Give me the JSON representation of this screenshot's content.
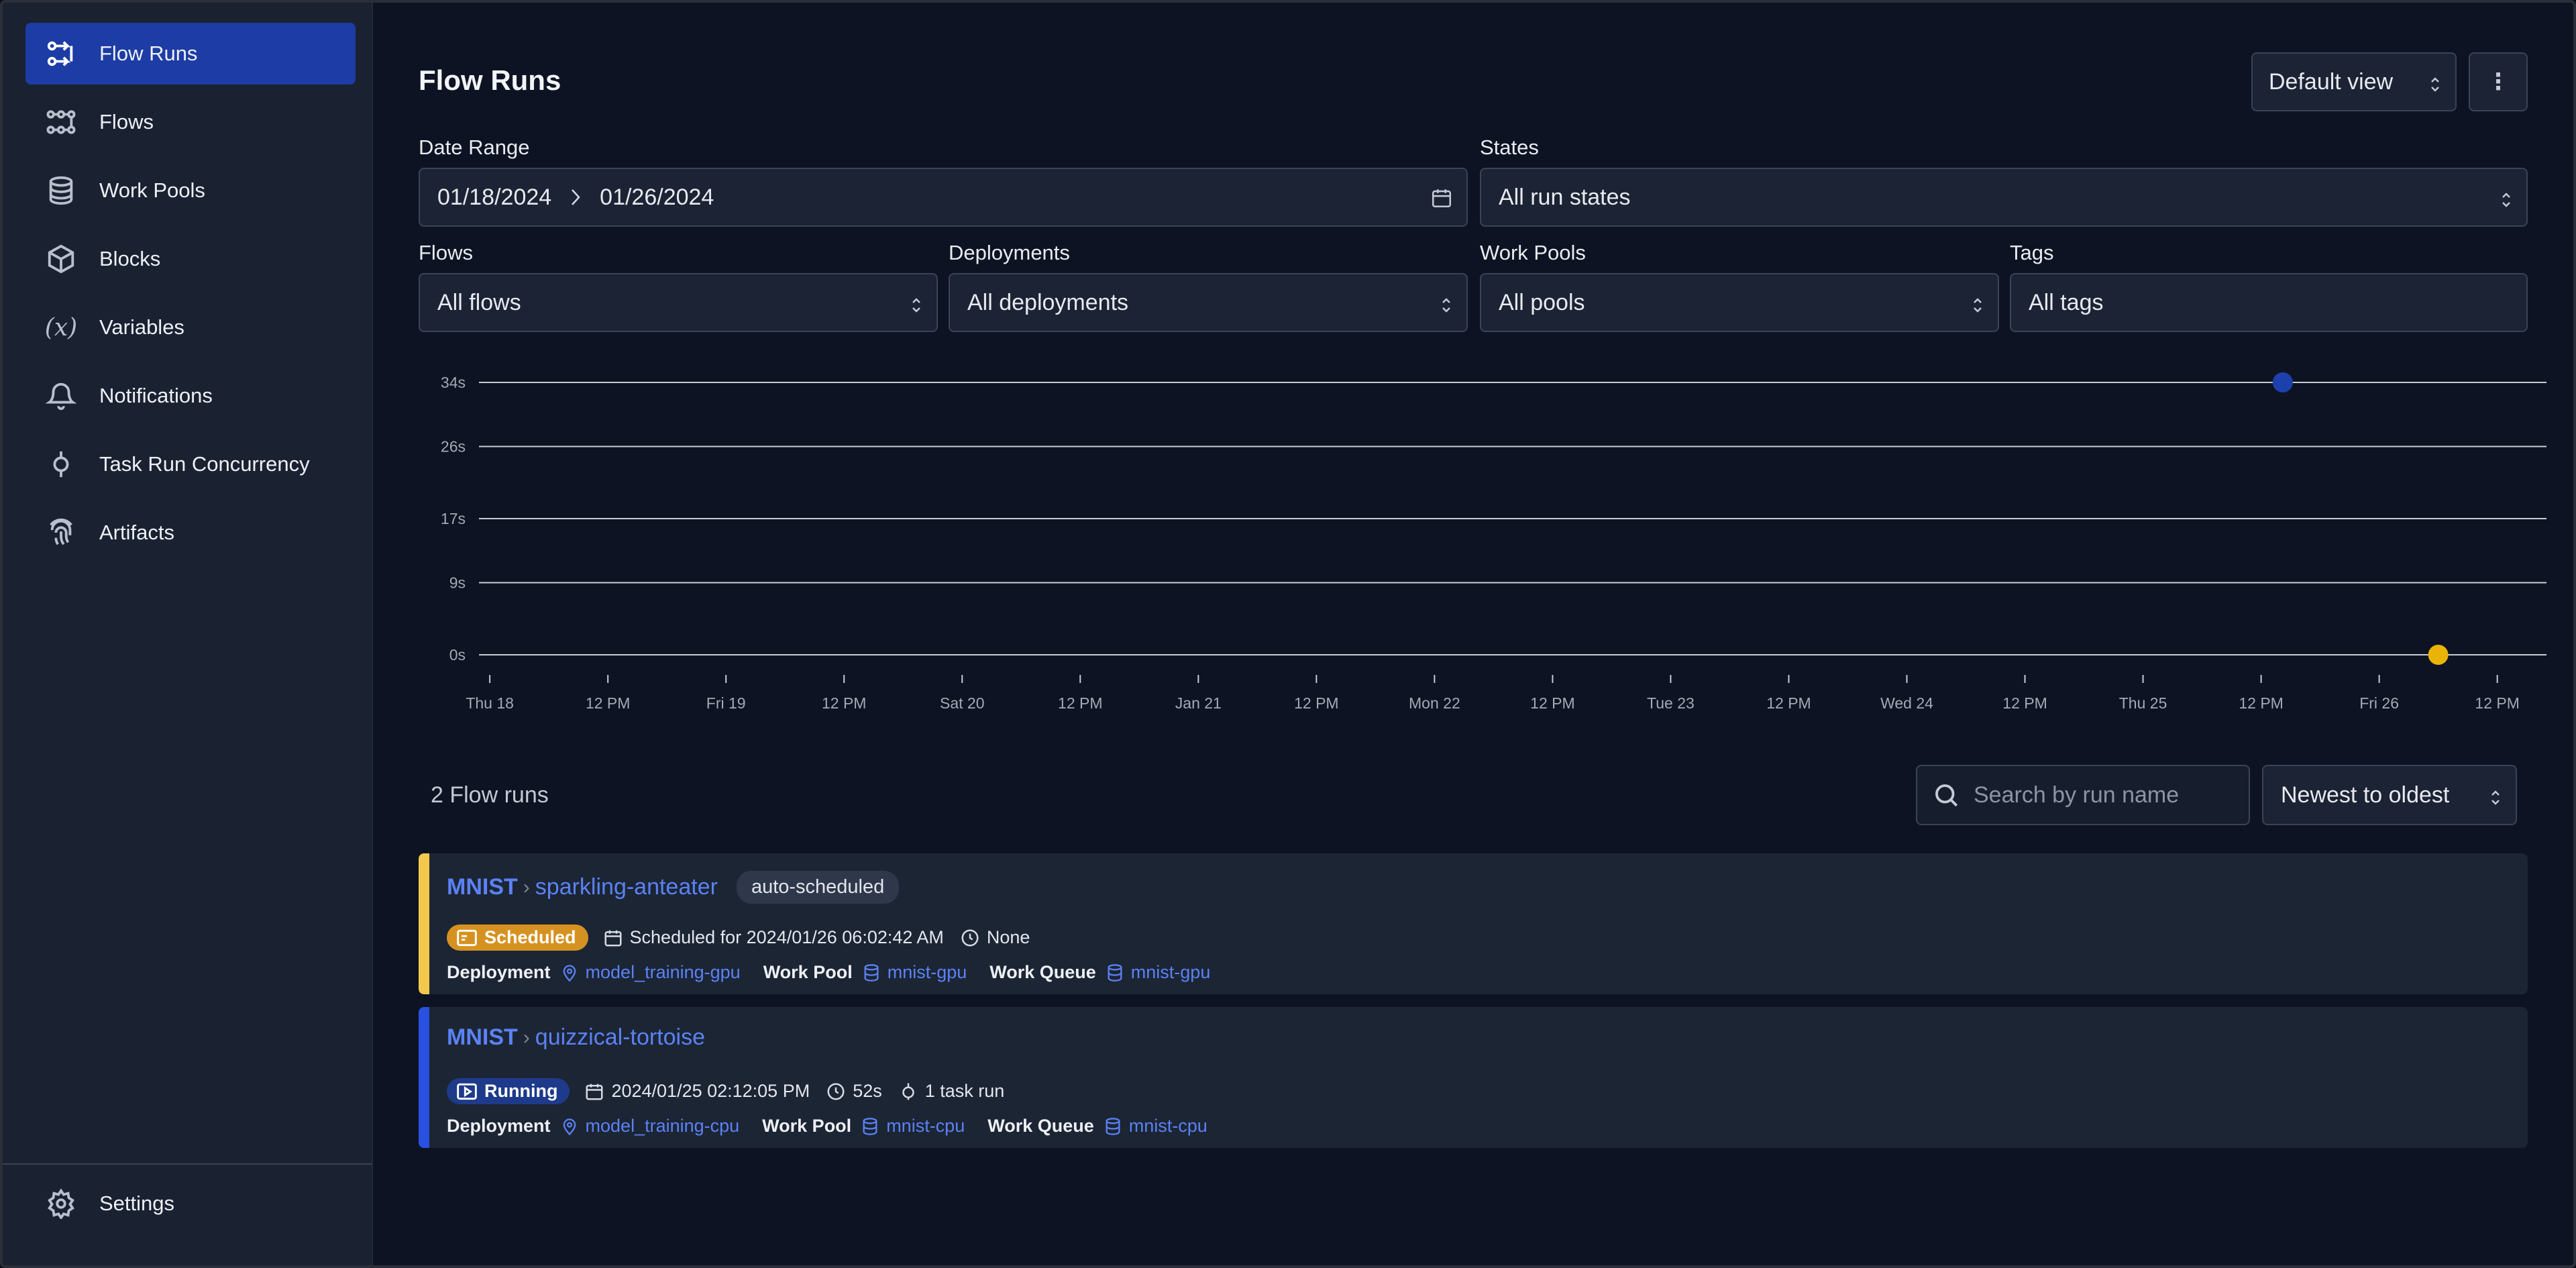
{
  "sidebar": {
    "items": [
      {
        "label": "Flow Runs",
        "icon": "flow-runs-icon",
        "active": true
      },
      {
        "label": "Flows",
        "icon": "flows-icon"
      },
      {
        "label": "Work Pools",
        "icon": "database-icon"
      },
      {
        "label": "Blocks",
        "icon": "cube-icon"
      },
      {
        "label": "Variables",
        "icon": "variable-icon"
      },
      {
        "label": "Notifications",
        "icon": "bell-icon"
      },
      {
        "label": "Task Run Concurrency",
        "icon": "concurrency-icon"
      },
      {
        "label": "Artifacts",
        "icon": "fingerprint-icon"
      }
    ],
    "settings": {
      "label": "Settings",
      "icon": "gear-icon"
    }
  },
  "header": {
    "title": "Flow Runs",
    "view": "Default view",
    "more": "⋮"
  },
  "filters": {
    "date_range": {
      "label": "Date Range",
      "start": "01/18/2024",
      "end": "01/26/2024"
    },
    "states": {
      "label": "States",
      "value": "All run states"
    },
    "flows": {
      "label": "Flows",
      "value": "All flows"
    },
    "deployments": {
      "label": "Deployments",
      "value": "All deployments"
    },
    "work_pools": {
      "label": "Work Pools",
      "value": "All pools"
    },
    "tags": {
      "label": "Tags",
      "value": "All tags"
    }
  },
  "chart_data": {
    "type": "scatter",
    "y_ticks": [
      "34s",
      "26s",
      "17s",
      "9s",
      "0s"
    ],
    "y_tick_values": [
      34,
      26,
      17,
      9,
      0
    ],
    "ylim": [
      0,
      34
    ],
    "x_ticks": [
      "Thu 18",
      "12 PM",
      "Fri 19",
      "12 PM",
      "Sat 20",
      "12 PM",
      "Jan 21",
      "12 PM",
      "Mon 22",
      "12 PM",
      "Tue 23",
      "12 PM",
      "Wed 24",
      "12 PM",
      "Thu 25",
      "12 PM",
      "Fri 26",
      "12 PM"
    ],
    "x_tick_hours": [
      0,
      12,
      24,
      36,
      48,
      60,
      72,
      84,
      96,
      108,
      120,
      132,
      144,
      156,
      168,
      180,
      192,
      204
    ],
    "xlim_hours": [
      -1.1,
      209
    ],
    "grid": true,
    "points": [
      {
        "run": "quizzical-tortoise",
        "state": "Running",
        "x": "2024-01-25 14:12:05",
        "x_hours": 182.2,
        "y": 34,
        "color": "#1e40af"
      },
      {
        "run": "sparkling-anteater",
        "state": "Scheduled",
        "x": "2024-01-26 06:02:42",
        "x_hours": 198.0,
        "y": 0,
        "color": "#eab308"
      }
    ]
  },
  "list": {
    "count": "2 Flow runs",
    "search_placeholder": "Search by run name",
    "sort": "Newest to oldest"
  },
  "runs": [
    {
      "flow": "MNIST",
      "name": "sparkling-anteater",
      "tag": "auto-scheduled",
      "state": "Scheduled",
      "state_color": "#d69220",
      "bar_color": "#f2c94c",
      "time": "Scheduled for 2024/01/26 06:02:42 AM",
      "duration": "None",
      "tasks": "",
      "deployment_label": "Deployment",
      "deployment": "model_training-gpu",
      "work_pool_label": "Work Pool",
      "work_pool": "mnist-gpu",
      "work_queue_label": "Work Queue",
      "work_queue": "mnist-gpu"
    },
    {
      "flow": "MNIST",
      "name": "quizzical-tortoise",
      "tag": "",
      "state": "Running",
      "state_color": "#1e3a8a",
      "bar_color": "#2a50e0",
      "time": "2024/01/25 02:12:05 PM",
      "duration": "52s",
      "tasks": "1 task run",
      "deployment_label": "Deployment",
      "deployment": "model_training-cpu",
      "work_pool_label": "Work Pool",
      "work_pool": "mnist-cpu",
      "work_queue_label": "Work Queue",
      "work_queue": "mnist-cpu"
    }
  ]
}
